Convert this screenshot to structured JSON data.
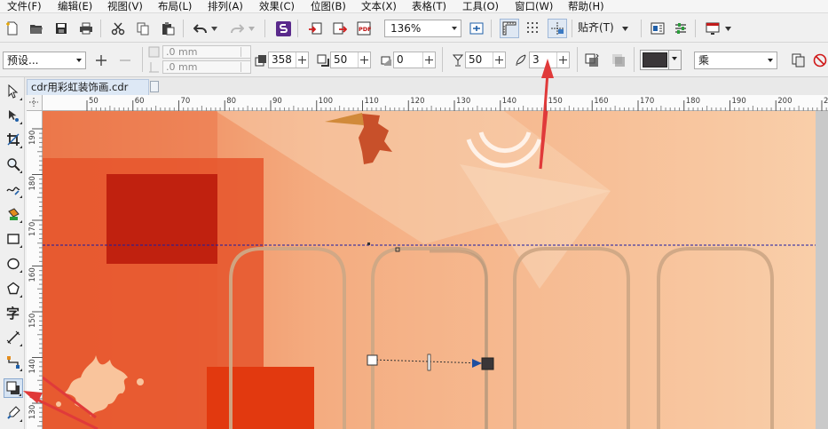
{
  "menu": [
    "文件(F)",
    "编辑(E)",
    "视图(V)",
    "布局(L)",
    "排列(A)",
    "效果(C)",
    "位图(B)",
    "文本(X)",
    "表格(T)",
    "工具(O)",
    "窗口(W)",
    "帮助(H)"
  ],
  "toolbar": {
    "zoom": "136%",
    "snap_label": "贴齐(T)"
  },
  "property_bar": {
    "preset": "预设...",
    "offset_x": ".0 mm",
    "offset_y": ".0 mm",
    "shadow_angle": "358",
    "shadow_stretch": "50",
    "shadow_fade_out": "0",
    "shadow_opacity": "50",
    "shadow_feather": "3",
    "shadow_color": "#3a3638",
    "blend_mode": "乘"
  },
  "document": {
    "tab_title": "cdr用彩虹装饰画.cdr"
  },
  "ruler": {
    "horizontal_ticks": [
      "50",
      "60",
      "70",
      "80",
      "90",
      "100",
      "110",
      "120",
      "130",
      "140",
      "150",
      "160",
      "170",
      "180",
      "190",
      "200",
      "210"
    ],
    "vertical_ticks": [
      "190",
      "180",
      "170",
      "160",
      "150",
      "140",
      "130"
    ]
  },
  "colors": {
    "canvas_background": "#f7cfa8",
    "accent_red": "#e04016",
    "guide_line": "#1a1aa6",
    "annotation_arrow": "#e03a3a"
  }
}
